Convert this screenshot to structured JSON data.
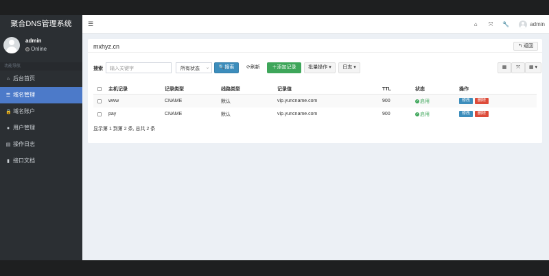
{
  "app": {
    "title": "聚合DNS管理系统"
  },
  "user": {
    "name": "admin",
    "status": "Online"
  },
  "sidebar": {
    "section_header": "功能导航",
    "items": [
      {
        "label": "后台首页",
        "icon": "home-icon",
        "active": false
      },
      {
        "label": "域名管理",
        "icon": "list-icon",
        "active": true
      },
      {
        "label": "域名账户",
        "icon": "lock-icon",
        "active": false
      },
      {
        "label": "用户管理",
        "icon": "user-icon",
        "active": false
      },
      {
        "label": "操作日志",
        "icon": "list-alt-icon",
        "active": false
      },
      {
        "label": "接口文档",
        "icon": "book-icon",
        "active": false
      }
    ]
  },
  "header": {
    "user": "admin",
    "icons": [
      "home-icon",
      "fullscreen-icon",
      "wrench-icon"
    ]
  },
  "panel": {
    "domain": "mxhyz.cn",
    "back_label": "返回"
  },
  "toolbar": {
    "search_label": "搜索",
    "search_placeholder": "输入关键字",
    "status_select": "所有状态",
    "search_button": "搜索",
    "refresh_button": "刷新",
    "add_button": "添加记录",
    "batch_button": "批量操作",
    "log_button": "日志"
  },
  "table": {
    "columns": [
      "主机记录",
      "记录类型",
      "线路类型",
      "记录值",
      "TTL",
      "状态",
      "操作"
    ],
    "rows": [
      {
        "host": "www",
        "type": "CNAME",
        "line": "默认",
        "value": "vip.yuncname.com",
        "ttl": "900",
        "status": "启用",
        "edit": "修改",
        "del": "删除"
      },
      {
        "host": "pay",
        "type": "CNAME",
        "line": "默认",
        "value": "vip.yuncname.com",
        "ttl": "900",
        "status": "启用",
        "edit": "修改",
        "del": "删除"
      }
    ],
    "summary": "显示第 1 到第 2 条, 总共 2 条"
  },
  "colors": {
    "accent": "#4c7ac9",
    "sidebar_bg": "#2b2f33",
    "success": "#3ea65a",
    "danger": "#dd4b39",
    "primary": "#3c8dbc"
  }
}
